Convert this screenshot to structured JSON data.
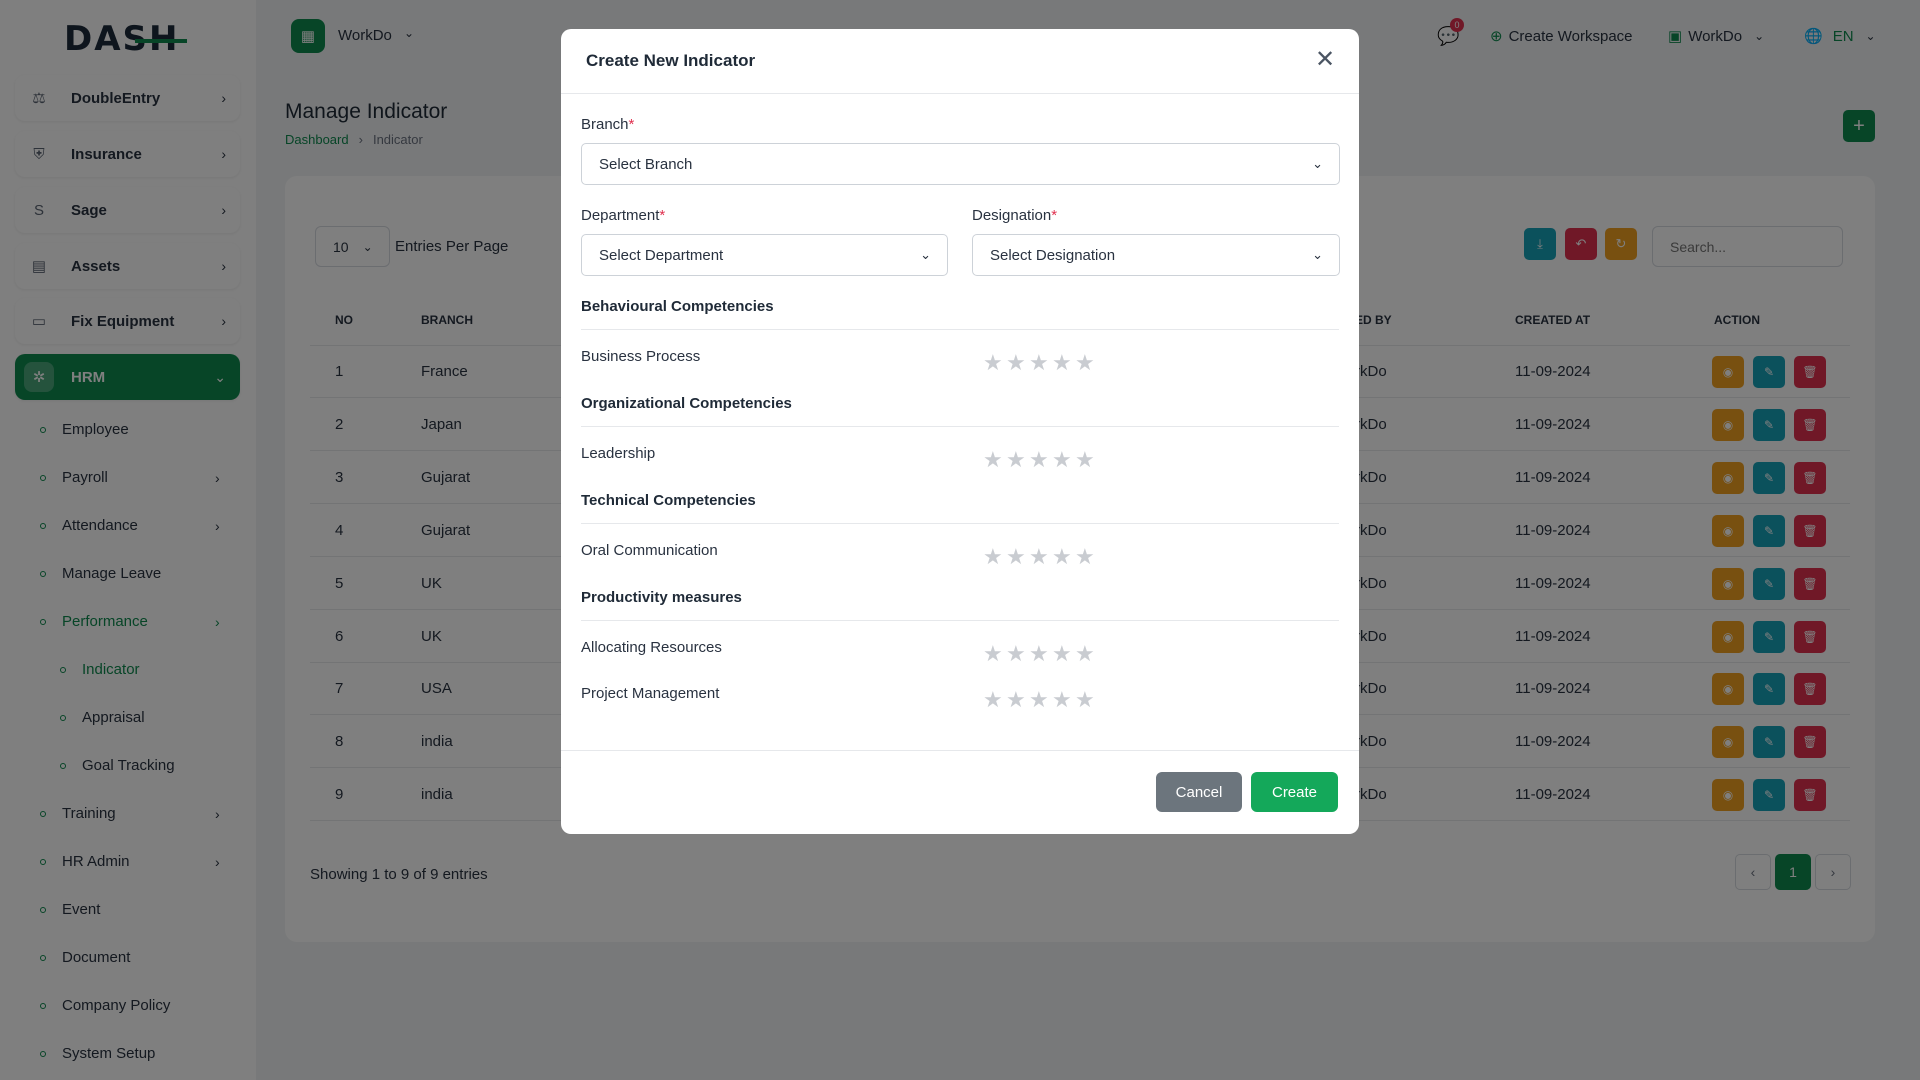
{
  "brand": {
    "logo": "DASH",
    "color": "#0e8a4f"
  },
  "sidebar": {
    "main_items": [
      {
        "label": "DoubleEntry",
        "icon": "scale-icon"
      },
      {
        "label": "Insurance",
        "icon": "shield-icon"
      },
      {
        "label": "Sage",
        "icon": "s-icon"
      },
      {
        "label": "Assets",
        "icon": "assets-icon"
      },
      {
        "label": "Fix Equipment",
        "icon": "archive-icon"
      },
      {
        "label": "HRM",
        "icon": "hrm-icon"
      }
    ],
    "hrm_items": [
      {
        "label": "Employee"
      },
      {
        "label": "Payroll"
      },
      {
        "label": "Attendance"
      },
      {
        "label": "Manage Leave"
      },
      {
        "label": "Performance"
      },
      {
        "label": "Indicator"
      },
      {
        "label": "Appraisal"
      },
      {
        "label": "Goal Tracking"
      },
      {
        "label": "Training"
      },
      {
        "label": "HR Admin"
      },
      {
        "label": "Event"
      },
      {
        "label": "Document"
      },
      {
        "label": "Company Policy"
      },
      {
        "label": "System Setup"
      }
    ]
  },
  "topbar": {
    "workspace": "WorkDo",
    "notif_count": "0",
    "create_workspace": "Create Workspace",
    "account": "WorkDo",
    "language": "EN"
  },
  "page": {
    "title": "Manage Indicator",
    "breadcrumb": {
      "home": "Dashboard",
      "sep": "›",
      "current": "Indicator"
    }
  },
  "table_controls": {
    "entries_value": "10",
    "entries_label": "Entries Per Page",
    "search_placeholder": "Search..."
  },
  "table": {
    "headers": {
      "no": "NO",
      "branch": "BRANCH",
      "created_by": "ED BY",
      "created_at": "CREATED AT",
      "action": "ACTION"
    },
    "rows": [
      {
        "no": "1",
        "branch": "France",
        "created_by": "rkDo",
        "created_at": "11-09-2024"
      },
      {
        "no": "2",
        "branch": "Japan",
        "created_by": "rkDo",
        "created_at": "11-09-2024"
      },
      {
        "no": "3",
        "branch": "Gujarat",
        "created_by": "rkDo",
        "created_at": "11-09-2024"
      },
      {
        "no": "4",
        "branch": "Gujarat",
        "created_by": "rkDo",
        "created_at": "11-09-2024"
      },
      {
        "no": "5",
        "branch": "UK",
        "created_by": "rkDo",
        "created_at": "11-09-2024"
      },
      {
        "no": "6",
        "branch": "UK",
        "created_by": "rkDo",
        "created_at": "11-09-2024"
      },
      {
        "no": "7",
        "branch": "USA",
        "created_by": "rkDo",
        "created_at": "11-09-2024"
      },
      {
        "no": "8",
        "branch": "india",
        "created_by": "rkDo",
        "created_at": "11-09-2024"
      },
      {
        "no": "9",
        "branch": "india",
        "created_by": "rkDo",
        "created_at": "11-09-2024"
      }
    ],
    "showing": "Showing 1 to 9 of 9 entries",
    "current_page": "1"
  },
  "modal": {
    "title": "Create New Indicator",
    "branch_label": "Branch",
    "branch_placeholder": "Select Branch",
    "department_label": "Department",
    "department_placeholder": "Select Department",
    "designation_label": "Designation",
    "designation_placeholder": "Select Designation",
    "required_mark": "*",
    "sections": [
      {
        "title": "Behavioural Competencies",
        "items": [
          "Business Process"
        ]
      },
      {
        "title": "Organizational Competencies",
        "items": [
          "Leadership"
        ]
      },
      {
        "title": "Technical Competencies",
        "items": [
          "Oral Communication"
        ]
      },
      {
        "title": "Productivity measures",
        "items": [
          "Allocating Resources",
          "Project Management"
        ]
      }
    ],
    "max_rating": 5,
    "cancel_label": "Cancel",
    "create_label": "Create",
    "colors": {
      "cancel": "#6c757d",
      "create": "#14a85a"
    }
  },
  "action_colors": {
    "view": "#f0a020",
    "edit": "#17a2b8",
    "delete": "#e0314f",
    "restore": "#e0314f",
    "sync": "#f0a020"
  }
}
